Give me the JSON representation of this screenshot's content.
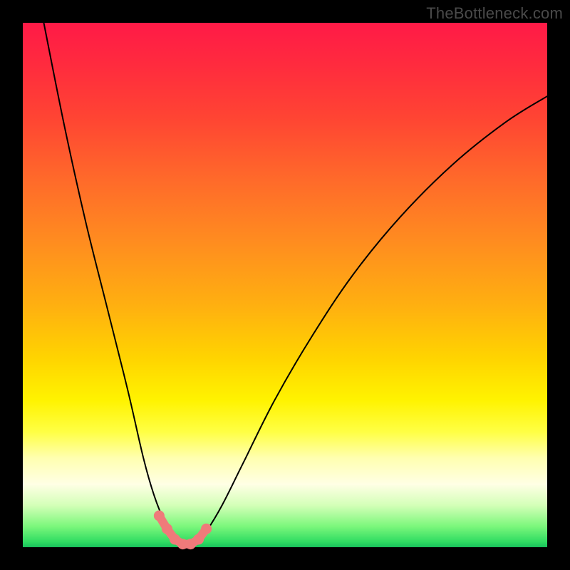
{
  "watermark": "TheBottleneck.com",
  "colors": {
    "background": "#000000",
    "gradient_top": "#ff1a47",
    "gradient_bottom": "#18c05c",
    "curve": "#000000",
    "dots": "#ef7a7a"
  },
  "chart_data": {
    "type": "line",
    "title": "",
    "xlabel": "",
    "ylabel": "",
    "xlim": [
      0,
      100
    ],
    "ylim": [
      0,
      100
    ],
    "curve_left": {
      "x": [
        4,
        8,
        12,
        16,
        20,
        23,
        25,
        27,
        29,
        30.5
      ],
      "y": [
        100,
        80,
        62,
        46,
        30,
        17,
        10,
        5,
        2,
        0.5
      ]
    },
    "curve_right": {
      "x": [
        33,
        35,
        38,
        42,
        48,
        55,
        63,
        72,
        82,
        92,
        100
      ],
      "y": [
        0.5,
        3,
        8,
        16,
        28,
        40,
        52,
        63,
        73,
        81,
        86
      ]
    },
    "dots": [
      {
        "x": 26.0,
        "y": 6.0
      },
      {
        "x": 27.5,
        "y": 3.5
      },
      {
        "x": 29.0,
        "y": 1.5
      },
      {
        "x": 30.5,
        "y": 0.6
      },
      {
        "x": 32.0,
        "y": 0.6
      },
      {
        "x": 33.5,
        "y": 1.5
      },
      {
        "x": 35.0,
        "y": 3.5
      }
    ]
  }
}
